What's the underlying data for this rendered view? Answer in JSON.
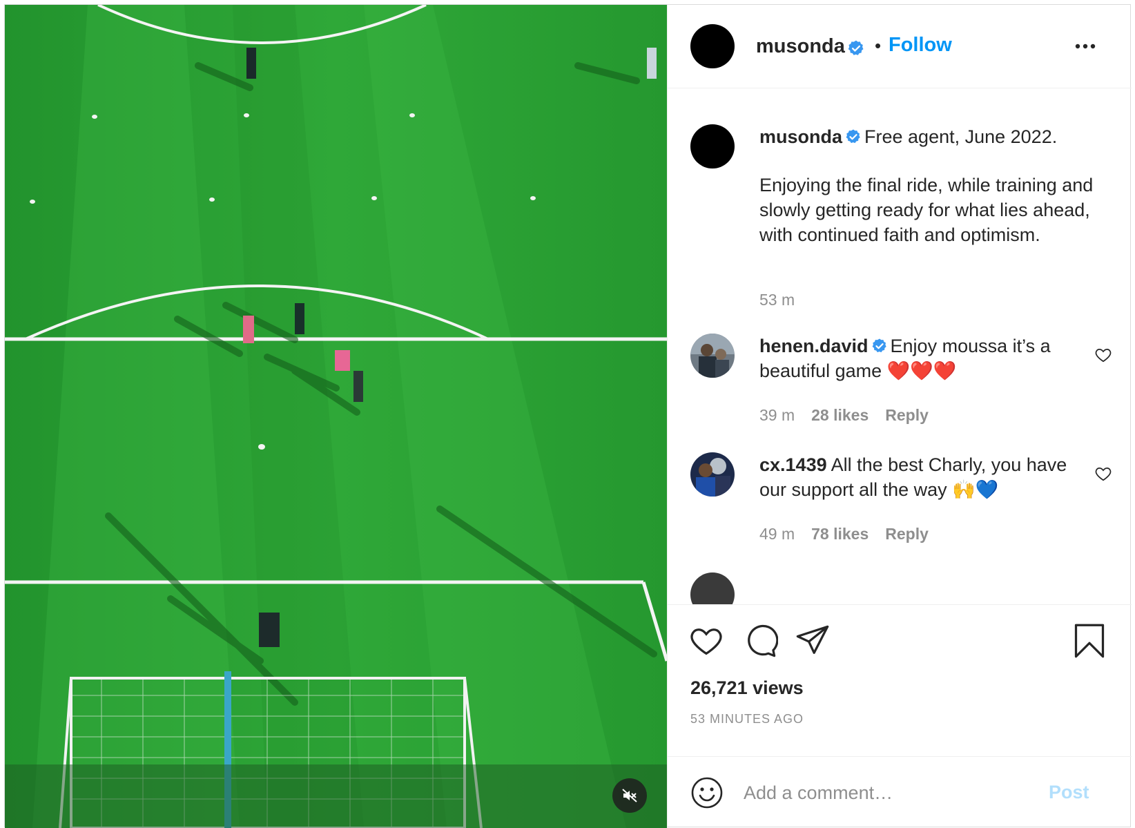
{
  "post": {
    "username": "musonda",
    "verified": true,
    "separator": "•",
    "follow_label": "Follow",
    "more_icon": "more-horizontal-icon",
    "media": {
      "type": "video",
      "description_icon": "muted-speaker-icon"
    }
  },
  "caption": {
    "username": "musonda",
    "headline": "Free agent, June 2022.",
    "body": "Enjoying the final ride, while training and slowly getting ready for what lies ahead, with continued faith and optimism.",
    "time": "53 m"
  },
  "comments": [
    {
      "username": "henen.david",
      "verified": true,
      "text": "Enjoy moussa it’s a beautiful game ❤️❤️❤️",
      "time": "39 m",
      "likes": "28 likes",
      "reply": "Reply"
    },
    {
      "username": "cx.1439",
      "verified": false,
      "text": "All the best Charly, you have our support all the way 🙌💙",
      "time": "49 m",
      "likes": "78 likes",
      "reply": "Reply"
    }
  ],
  "actions": {
    "like_icon": "heart-icon",
    "comment_icon": "comment-icon",
    "share_icon": "paper-plane-icon",
    "save_icon": "bookmark-icon"
  },
  "stats": {
    "views": "26,721 views",
    "posted": "53 MINUTES AGO"
  },
  "add_comment": {
    "placeholder": "Add a comment…",
    "post_label": "Post"
  },
  "colors": {
    "accent": "#0095f6",
    "post_disabled": "#b2dffc",
    "verified": "#3897f0",
    "heart_red": "#e0245e"
  }
}
